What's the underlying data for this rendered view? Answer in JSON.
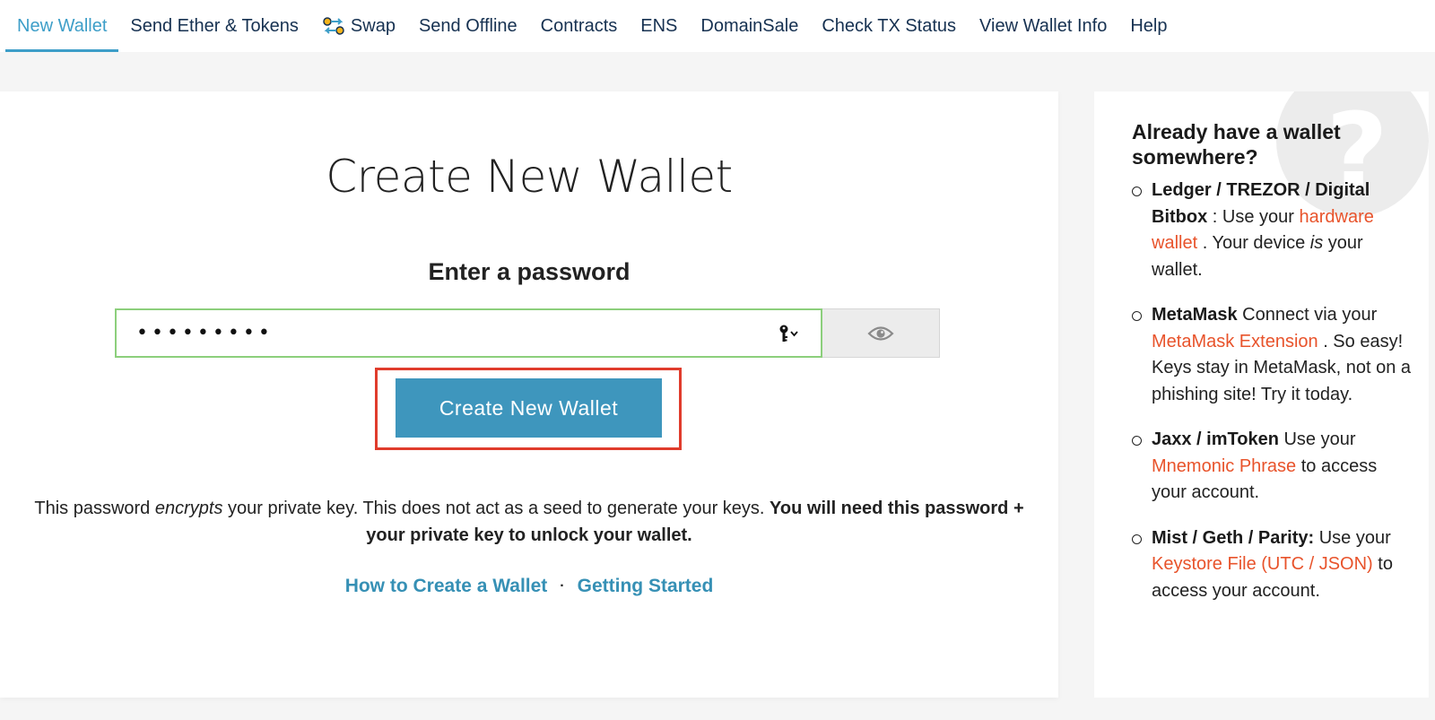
{
  "nav": {
    "items": [
      {
        "label": "New Wallet",
        "active": true
      },
      {
        "label": "Send Ether & Tokens"
      },
      {
        "label": "Swap",
        "icon": "swap-icon"
      },
      {
        "label": "Send Offline"
      },
      {
        "label": "Contracts"
      },
      {
        "label": "ENS"
      },
      {
        "label": "DomainSale"
      },
      {
        "label": "Check TX Status"
      },
      {
        "label": "View Wallet Info"
      },
      {
        "label": "Help"
      }
    ]
  },
  "main": {
    "title": "Create New Wallet",
    "password_heading": "Enter a password",
    "password_value": "•••••••••",
    "password_masked": true,
    "create_button": "Create New Wallet",
    "note": {
      "part1": "This password ",
      "emphasis": "encrypts",
      "part2": " your private key. This does not act as a seed to generate your keys. ",
      "bold": "You will need this password + your private key to unlock your wallet."
    },
    "links": {
      "how_to": "How to Create a Wallet",
      "separator": "·",
      "getting_started": "Getting Started"
    }
  },
  "sidebar": {
    "title": "Already have a wallet somewhere?",
    "question_mark": "?",
    "items": [
      {
        "name": "Ledger / TREZOR / Digital Bitbox",
        "text1": " : Use your ",
        "link": "hardware wallet",
        "text2": " . Your device ",
        "italic": "is",
        "text3": " your wallet."
      },
      {
        "name": "MetaMask",
        "text1": " Connect via your ",
        "link": "MetaMask Extension",
        "text2": " . So easy! Keys stay in MetaMask, not on a phishing site! Try it today."
      },
      {
        "name": "Jaxx / imToken",
        "text1": " Use your ",
        "link": "Mnemonic Phrase",
        "text2": " to access your account."
      },
      {
        "name": "Mist / Geth / Parity:",
        "text1": " Use your ",
        "link": "Keystore File (UTC / JSON)",
        "text2": " to access your account."
      }
    ]
  },
  "colors": {
    "accent": "#3d9ec8",
    "button": "#3e96bd",
    "link_orange": "#e8532b",
    "highlight_outline": "#e03c2c",
    "valid_border": "#8ccf7c"
  }
}
